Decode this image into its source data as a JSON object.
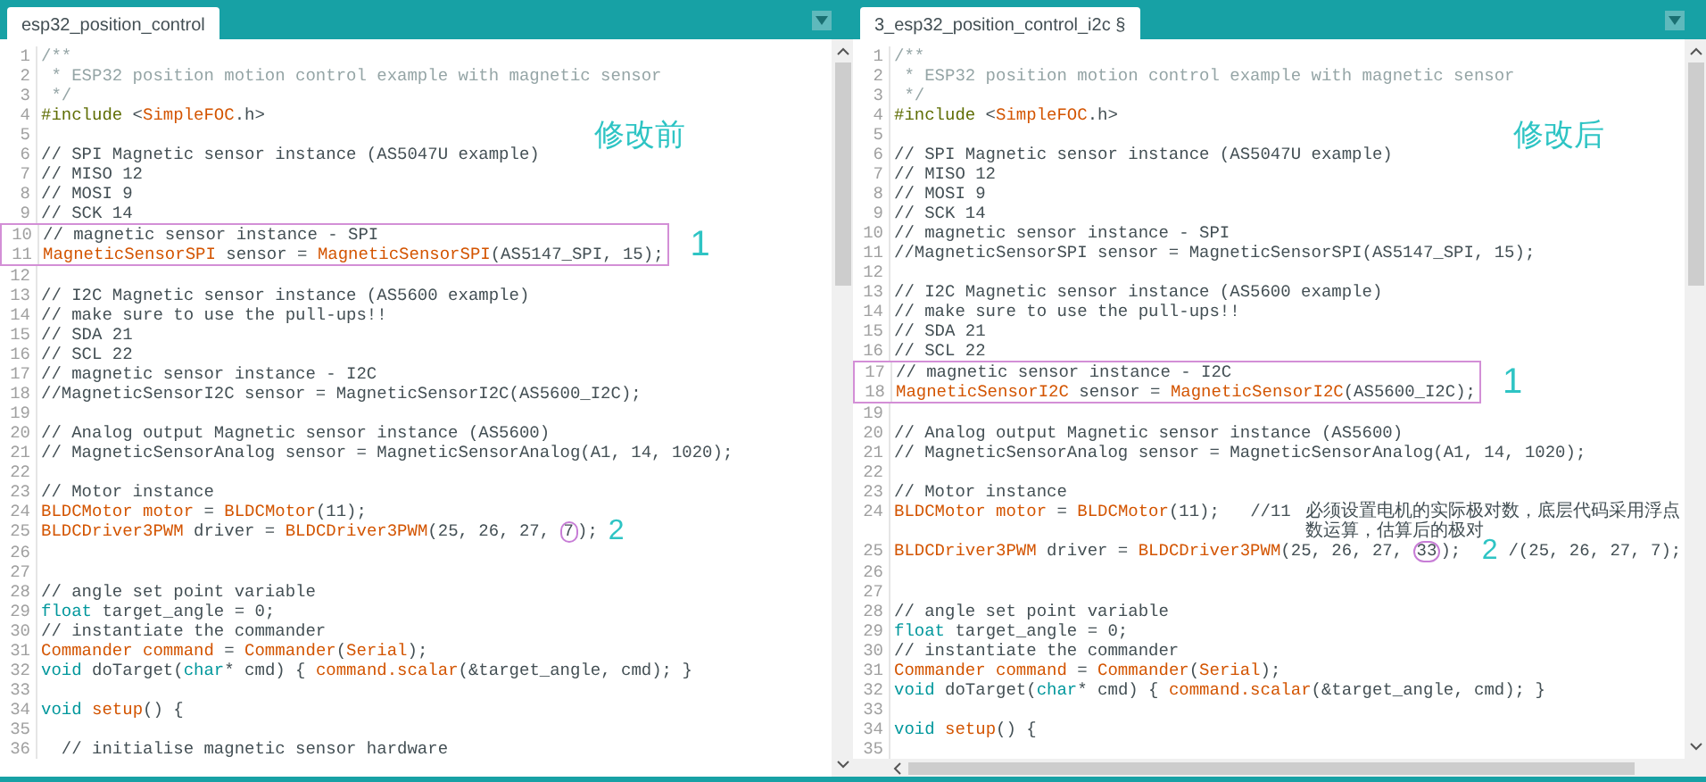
{
  "panes": [
    {
      "tab": "esp32_position_control",
      "overlay": "修改前",
      "lines": [
        {
          "number": "1",
          "segments": [
            {
              "kind": "doc",
              "text": "/**"
            }
          ]
        },
        {
          "number": "2",
          "segments": [
            {
              "kind": "doc",
              "text": " * ESP32 position motion control example with magnetic sensor"
            }
          ]
        },
        {
          "number": "3",
          "segments": [
            {
              "kind": "doc",
              "text": " */"
            }
          ]
        },
        {
          "number": "4",
          "segments": [
            {
              "kind": "include",
              "text": "#include"
            },
            {
              "kind": "plain",
              "text": " <"
            },
            {
              "kind": "keyword",
              "text": "SimpleFOC"
            },
            {
              "kind": "plain",
              "text": ".h>"
            }
          ]
        },
        {
          "number": "5"
        },
        {
          "number": "6",
          "segments": [
            {
              "kind": "comment",
              "text": "// SPI Magnetic sensor instance (AS5047U example)"
            }
          ]
        },
        {
          "number": "7",
          "segments": [
            {
              "kind": "comment",
              "text": "// MISO 12"
            }
          ]
        },
        {
          "number": "8",
          "segments": [
            {
              "kind": "comment",
              "text": "// MOSI 9"
            }
          ]
        },
        {
          "number": "9",
          "segments": [
            {
              "kind": "comment",
              "text": "// SCK 14"
            }
          ]
        },
        {
          "number": "10",
          "boxed": true,
          "segments": [
            {
              "kind": "comment",
              "text": "// magnetic sensor instance - SPI"
            }
          ]
        },
        {
          "number": "11",
          "boxed": true,
          "note": "1",
          "segments": [
            {
              "kind": "keyword",
              "text": "MagneticSensorSPI"
            },
            {
              "kind": "plain",
              "text": " sensor = "
            },
            {
              "kind": "keyword",
              "text": "MagneticSensorSPI"
            },
            {
              "kind": "plain",
              "text": "(AS5147_SPI, 15);"
            }
          ]
        },
        {
          "number": "12"
        },
        {
          "number": "13",
          "segments": [
            {
              "kind": "comment",
              "text": "// I2C Magnetic sensor instance (AS5600 example)"
            }
          ]
        },
        {
          "number": "14",
          "segments": [
            {
              "kind": "comment",
              "text": "// make sure to use the pull-ups!!"
            }
          ]
        },
        {
          "number": "15",
          "segments": [
            {
              "kind": "comment",
              "text": "// SDA 21"
            }
          ]
        },
        {
          "number": "16",
          "segments": [
            {
              "kind": "comment",
              "text": "// SCL 22"
            }
          ]
        },
        {
          "number": "17",
          "segments": [
            {
              "kind": "comment",
              "text": "// magnetic sensor instance - I2C"
            }
          ]
        },
        {
          "number": "18",
          "segments": [
            {
              "kind": "comment",
              "text": "//MagneticSensorI2C sensor = MagneticSensorI2C(AS5600_I2C);"
            }
          ]
        },
        {
          "number": "19"
        },
        {
          "number": "20",
          "segments": [
            {
              "kind": "comment",
              "text": "// Analog output Magnetic sensor instance (AS5600)"
            }
          ]
        },
        {
          "number": "21",
          "segments": [
            {
              "kind": "comment",
              "text": "// MagneticSensorAnalog sensor = MagneticSensorAnalog(A1, 14, 1020);"
            }
          ]
        },
        {
          "number": "22"
        },
        {
          "number": "23",
          "segments": [
            {
              "kind": "comment",
              "text": "// Motor instance"
            }
          ]
        },
        {
          "number": "24",
          "segments": [
            {
              "kind": "keyword",
              "text": "BLDCMotor"
            },
            {
              "kind": "keyword",
              "text": " motor"
            },
            {
              "kind": "plain",
              "text": " = "
            },
            {
              "kind": "keyword",
              "text": "BLDCMotor"
            },
            {
              "kind": "plain",
              "text": "(11);"
            }
          ]
        },
        {
          "number": "25",
          "segments": [
            {
              "kind": "keyword",
              "text": "BLDCDriver3PWM"
            },
            {
              "kind": "plain",
              "text": " driver = "
            },
            {
              "kind": "keyword",
              "text": "BLDCDriver3PWM"
            },
            {
              "kind": "plain",
              "text": "(25, 26, 27, "
            },
            {
              "kind": "circled",
              "text": "7"
            },
            {
              "kind": "plain",
              "text": ");"
            },
            {
              "kind": "note",
              "text": "2"
            }
          ]
        },
        {
          "number": "26"
        },
        {
          "number": "27"
        },
        {
          "number": "28",
          "segments": [
            {
              "kind": "comment",
              "text": "// angle set point variable"
            }
          ]
        },
        {
          "number": "29",
          "segments": [
            {
              "kind": "type",
              "text": "float"
            },
            {
              "kind": "plain",
              "text": " target_angle = 0;"
            }
          ]
        },
        {
          "number": "30",
          "segments": [
            {
              "kind": "comment",
              "text": "// instantiate the commander"
            }
          ]
        },
        {
          "number": "31",
          "segments": [
            {
              "kind": "keyword",
              "text": "Commander"
            },
            {
              "kind": "keyword",
              "text": " command"
            },
            {
              "kind": "plain",
              "text": " = "
            },
            {
              "kind": "keyword",
              "text": "Commander"
            },
            {
              "kind": "plain",
              "text": "("
            },
            {
              "kind": "keyword",
              "text": "Serial"
            },
            {
              "kind": "plain",
              "text": ");"
            }
          ]
        },
        {
          "number": "32",
          "segments": [
            {
              "kind": "type",
              "text": "void"
            },
            {
              "kind": "plain",
              "text": " doTarget("
            },
            {
              "kind": "type",
              "text": "char"
            },
            {
              "kind": "plain",
              "text": "* cmd) { "
            },
            {
              "kind": "keyword",
              "text": "command.scalar"
            },
            {
              "kind": "plain",
              "text": "(&target_angle, cmd); }"
            }
          ]
        },
        {
          "number": "33"
        },
        {
          "number": "34",
          "segments": [
            {
              "kind": "type",
              "text": "void"
            },
            {
              "kind": "keyword",
              "text": " setup"
            },
            {
              "kind": "plain",
              "text": "() {"
            }
          ]
        },
        {
          "number": "35"
        },
        {
          "number": "36",
          "segments": [
            {
              "kind": "comment",
              "text": "  // initialise magnetic sensor hardware"
            }
          ]
        }
      ]
    },
    {
      "tab": "3_esp32_position_control_i2c §",
      "overlay": "修改后",
      "hscroll": true,
      "lines": [
        {
          "number": "1",
          "segments": [
            {
              "kind": "doc",
              "text": "/**"
            }
          ]
        },
        {
          "number": "2",
          "segments": [
            {
              "kind": "doc",
              "text": " * ESP32 position motion control example with magnetic sensor"
            }
          ]
        },
        {
          "number": "3",
          "segments": [
            {
              "kind": "doc",
              "text": " */"
            }
          ]
        },
        {
          "number": "4",
          "segments": [
            {
              "kind": "include",
              "text": "#include"
            },
            {
              "kind": "plain",
              "text": " <"
            },
            {
              "kind": "keyword",
              "text": "SimpleFOC"
            },
            {
              "kind": "plain",
              "text": ".h>"
            }
          ]
        },
        {
          "number": "5"
        },
        {
          "number": "6",
          "segments": [
            {
              "kind": "comment",
              "text": "// SPI Magnetic sensor instance (AS5047U example)"
            }
          ]
        },
        {
          "number": "7",
          "segments": [
            {
              "kind": "comment",
              "text": "// MISO 12"
            }
          ]
        },
        {
          "number": "8",
          "segments": [
            {
              "kind": "comment",
              "text": "// MOSI 9"
            }
          ]
        },
        {
          "number": "9",
          "segments": [
            {
              "kind": "comment",
              "text": "// SCK 14"
            }
          ]
        },
        {
          "number": "10",
          "segments": [
            {
              "kind": "comment",
              "text": "// magnetic sensor instance - SPI"
            }
          ]
        },
        {
          "number": "11",
          "segments": [
            {
              "kind": "comment",
              "text": "//MagneticSensorSPI sensor = MagneticSensorSPI(AS5147_SPI, 15);"
            }
          ]
        },
        {
          "number": "12"
        },
        {
          "number": "13",
          "segments": [
            {
              "kind": "comment",
              "text": "// I2C Magnetic sensor instance (AS5600 example)"
            }
          ]
        },
        {
          "number": "14",
          "segments": [
            {
              "kind": "comment",
              "text": "// make sure to use the pull-ups!!"
            }
          ]
        },
        {
          "number": "15",
          "segments": [
            {
              "kind": "comment",
              "text": "// SDA 21"
            }
          ]
        },
        {
          "number": "16",
          "segments": [
            {
              "kind": "comment",
              "text": "// SCL 22"
            }
          ]
        },
        {
          "number": "17",
          "boxed": true,
          "segments": [
            {
              "kind": "comment",
              "text": "// magnetic sensor instance - I2C"
            }
          ]
        },
        {
          "number": "18",
          "boxed": true,
          "note": "1",
          "segments": [
            {
              "kind": "keyword",
              "text": "MagneticSensorI2C"
            },
            {
              "kind": "plain",
              "text": " sensor = "
            },
            {
              "kind": "keyword",
              "text": "MagneticSensorI2C"
            },
            {
              "kind": "plain",
              "text": "(AS5600_I2C);"
            }
          ]
        },
        {
          "number": "19"
        },
        {
          "number": "20",
          "segments": [
            {
              "kind": "comment",
              "text": "// Analog output Magnetic sensor instance (AS5600)"
            }
          ]
        },
        {
          "number": "21",
          "segments": [
            {
              "kind": "comment",
              "text": "// MagneticSensorAnalog sensor = MagneticSensorAnalog(A1, 14, 1020);"
            }
          ]
        },
        {
          "number": "22"
        },
        {
          "number": "23",
          "segments": [
            {
              "kind": "comment",
              "text": "// Motor instance"
            }
          ]
        },
        {
          "number": "24",
          "segments": [
            {
              "kind": "keyword",
              "text": "BLDCMotor"
            },
            {
              "kind": "keyword",
              "text": " motor"
            },
            {
              "kind": "plain",
              "text": " = "
            },
            {
              "kind": "keyword",
              "text": "BLDCMotor"
            },
            {
              "kind": "plain",
              "text": "(11);   "
            },
            {
              "kind": "comment",
              "text": "//11"
            },
            {
              "kind": "cjk_comment",
              "text": "必须设置电机的实际极对数，底层代码采用浮点数运算，估算后的极对"
            }
          ]
        },
        {
          "number": "25",
          "segments": [
            {
              "kind": "keyword",
              "text": "BLDCDriver3PWM"
            },
            {
              "kind": "plain",
              "text": " driver = "
            },
            {
              "kind": "keyword",
              "text": "BLDCDriver3PWM"
            },
            {
              "kind": "plain",
              "text": "(25, 26, 27, "
            },
            {
              "kind": "circled",
              "text": "33"
            },
            {
              "kind": "plain",
              "text": "); "
            },
            {
              "kind": "note",
              "text": "2"
            },
            {
              "kind": "comment",
              "text": "/(25, 26, 27, 7);"
            }
          ]
        },
        {
          "number": "26"
        },
        {
          "number": "27"
        },
        {
          "number": "28",
          "segments": [
            {
              "kind": "comment",
              "text": "// angle set point variable"
            }
          ]
        },
        {
          "number": "29",
          "segments": [
            {
              "kind": "type",
              "text": "float"
            },
            {
              "kind": "plain",
              "text": " target_angle = 0;"
            }
          ]
        },
        {
          "number": "30",
          "segments": [
            {
              "kind": "comment",
              "text": "// instantiate the commander"
            }
          ]
        },
        {
          "number": "31",
          "segments": [
            {
              "kind": "keyword",
              "text": "Commander"
            },
            {
              "kind": "keyword",
              "text": " command"
            },
            {
              "kind": "plain",
              "text": " = "
            },
            {
              "kind": "keyword",
              "text": "Commander"
            },
            {
              "kind": "plain",
              "text": "("
            },
            {
              "kind": "keyword",
              "text": "Serial"
            },
            {
              "kind": "plain",
              "text": ");"
            }
          ]
        },
        {
          "number": "32",
          "segments": [
            {
              "kind": "type",
              "text": "void"
            },
            {
              "kind": "plain",
              "text": " doTarget("
            },
            {
              "kind": "type",
              "text": "char"
            },
            {
              "kind": "plain",
              "text": "* cmd) { "
            },
            {
              "kind": "keyword",
              "text": "command.scalar"
            },
            {
              "kind": "plain",
              "text": "(&target_angle, cmd); }"
            }
          ]
        },
        {
          "number": "33"
        },
        {
          "number": "34",
          "segments": [
            {
              "kind": "type",
              "text": "void"
            },
            {
              "kind": "keyword",
              "text": " setup"
            },
            {
              "kind": "plain",
              "text": "() {"
            }
          ]
        },
        {
          "number": "35"
        }
      ]
    }
  ]
}
